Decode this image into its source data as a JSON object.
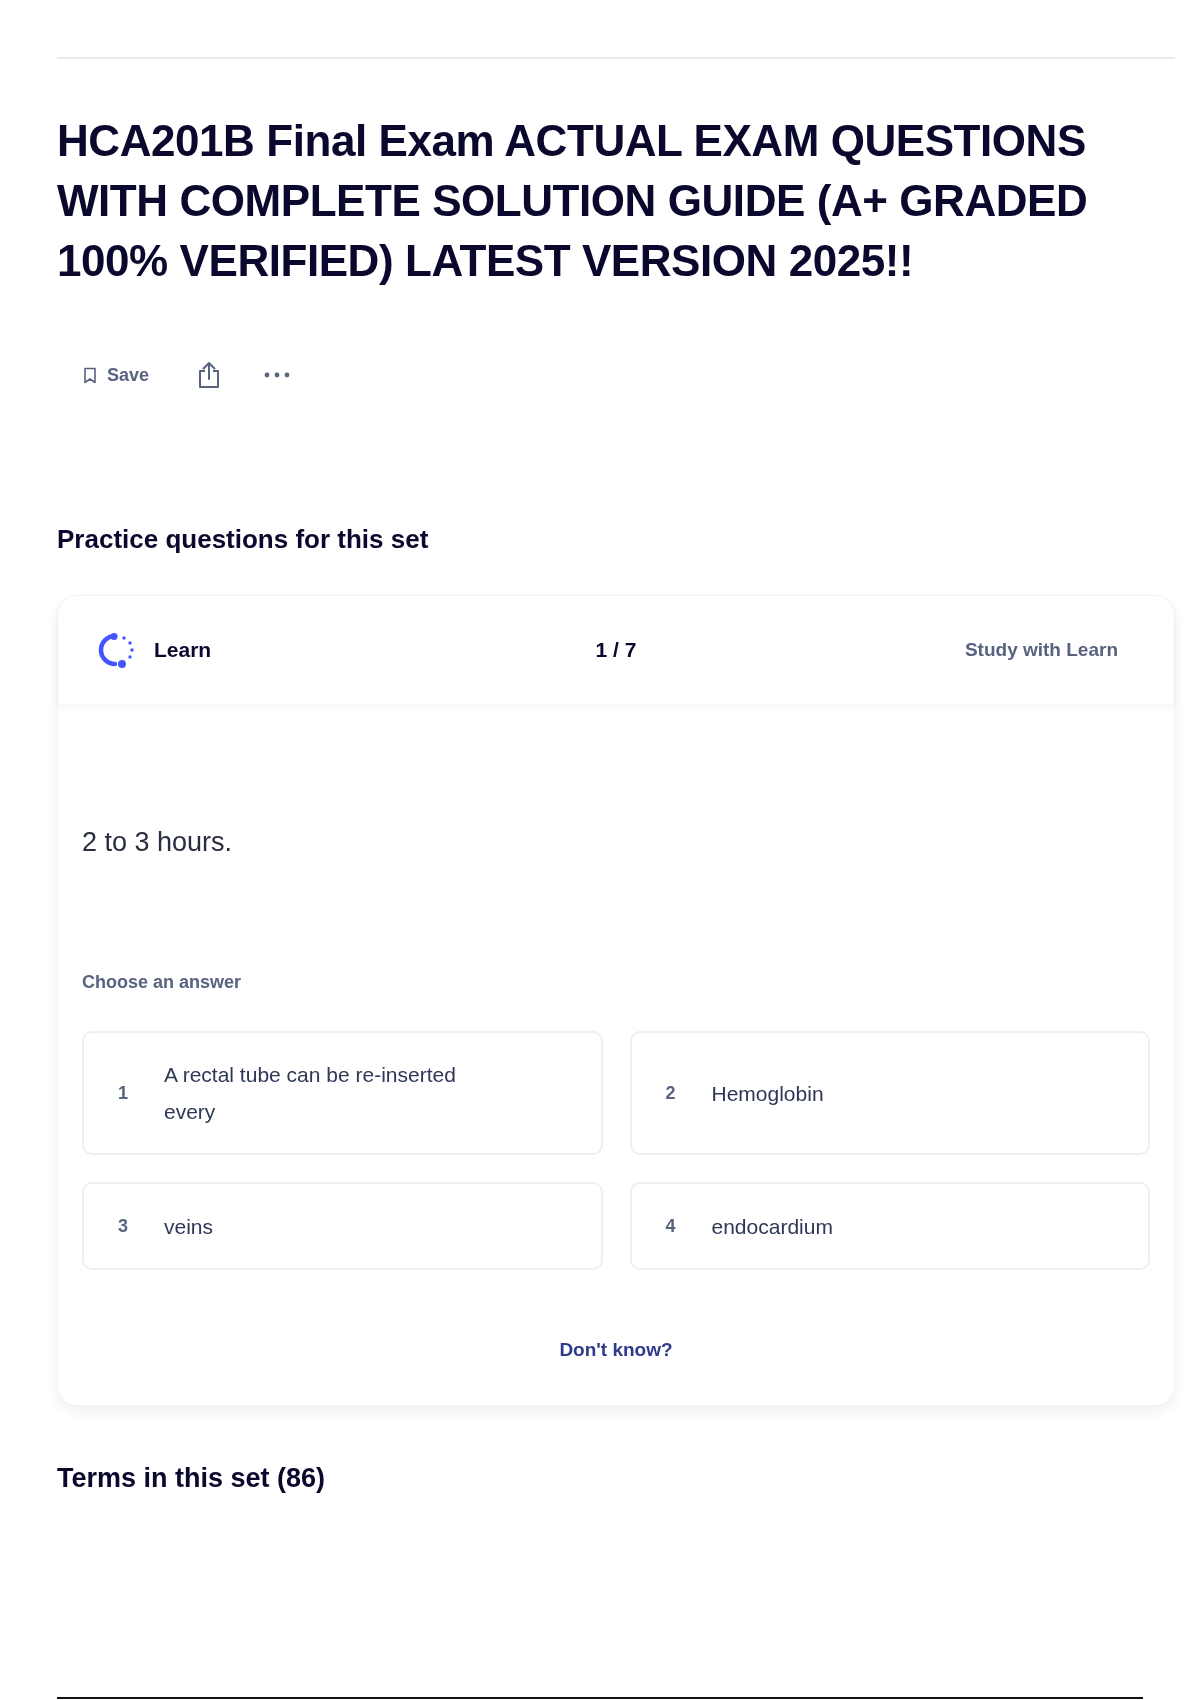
{
  "title": "HCA201B Final Exam ACTUAL EXAM QUESTIONS WITH COMPLETE SOLUTION GUIDE (A+ GRADED 100% VERIFIED) LATEST VERSION 2025!!",
  "toolbar": {
    "save_label": "Save"
  },
  "practice_heading": "Practice questions for this set",
  "learn_card": {
    "mode_label": "Learn",
    "progress": "1 / 7",
    "study_link": "Study with Learn",
    "question": "2 to 3 hours.",
    "prompt": "Choose an answer",
    "options": [
      {
        "number": "1",
        "text": "A rectal tube can be re-inserted every"
      },
      {
        "number": "2",
        "text": "Hemoglobin"
      },
      {
        "number": "3",
        "text": "veins"
      },
      {
        "number": "4",
        "text": "endocardium"
      }
    ],
    "dont_know": "Don't know?"
  },
  "terms_heading": "Terms in this set (86)"
}
